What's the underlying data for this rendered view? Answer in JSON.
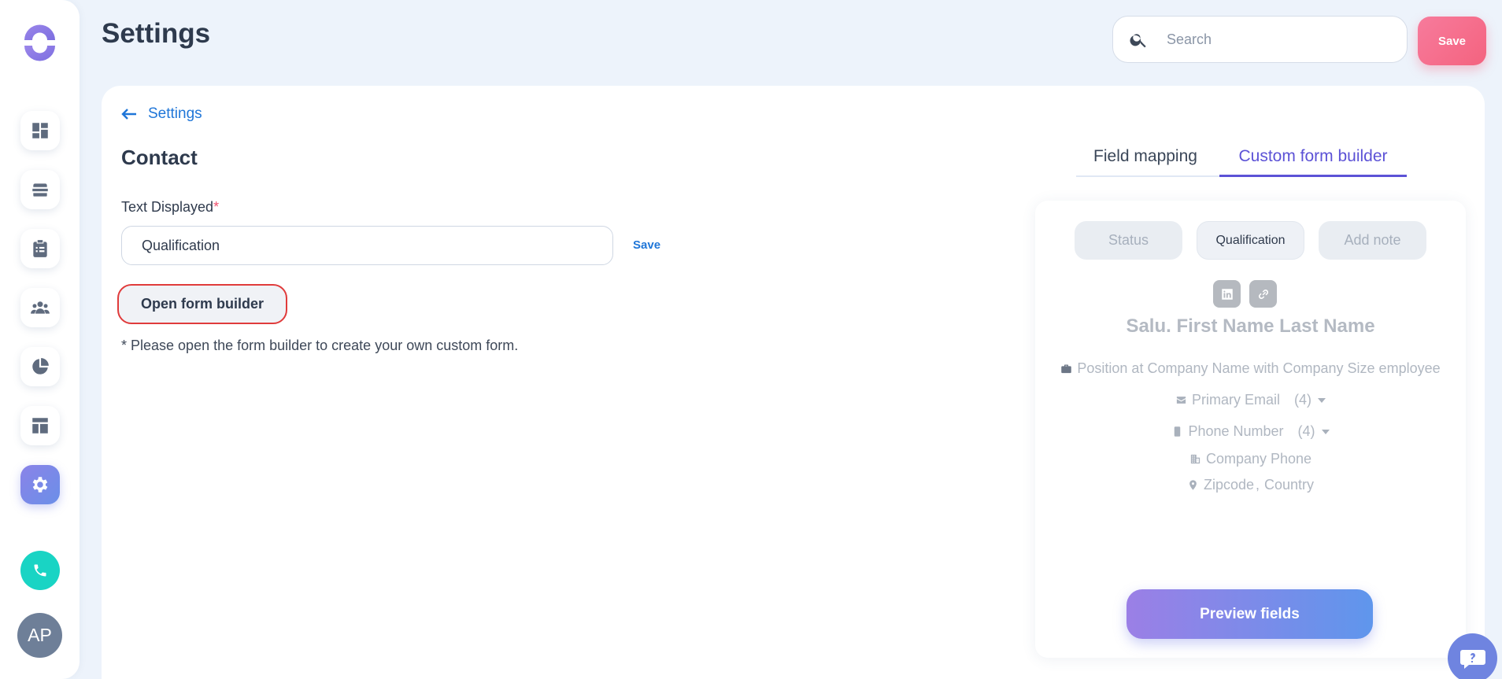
{
  "header": {
    "title": "Settings",
    "search_placeholder": "Search",
    "save_label": "Save"
  },
  "sidebar": {
    "items": [
      {
        "icon": "dashboard-icon"
      },
      {
        "icon": "stack-icon"
      },
      {
        "icon": "clipboard-icon"
      },
      {
        "icon": "people-icon"
      },
      {
        "icon": "pie-chart-icon"
      },
      {
        "icon": "layout-icon"
      },
      {
        "icon": "gear-icon",
        "active": true
      }
    ],
    "phone_icon": "phone-icon",
    "avatar_initials": "AP"
  },
  "main": {
    "back_label": "Settings",
    "section_title": "Contact",
    "field_label": "Text Displayed",
    "required_mark": "*",
    "field_value": "Qualification",
    "inline_save_label": "Save",
    "open_builder_label": "Open form builder",
    "note": "* Please open the form builder to create your own custom form."
  },
  "tabs": [
    {
      "label": "Field mapping",
      "active": false
    },
    {
      "label": "Custom form builder",
      "active": true
    }
  ],
  "preview": {
    "pills": [
      "Status",
      "Qualification",
      "Add note"
    ],
    "name": "Salu. First Name Last Name",
    "position": "Position at Company Name with Company Size employee",
    "email": "Primary Email",
    "email_count": "(4)",
    "phone": "Phone Number",
    "phone_count": "(4)",
    "company_phone": "Company Phone",
    "zipcode": "Zipcode",
    "country_sep": ",",
    "country": "Country",
    "button_label": "Preview fields"
  },
  "colors": {
    "accent": "#5c52d6",
    "save_button": "#f4637f",
    "active_nav": "#7e8be8",
    "phone_button": "#19d4c4",
    "highlight_border": "#e03b3b"
  }
}
